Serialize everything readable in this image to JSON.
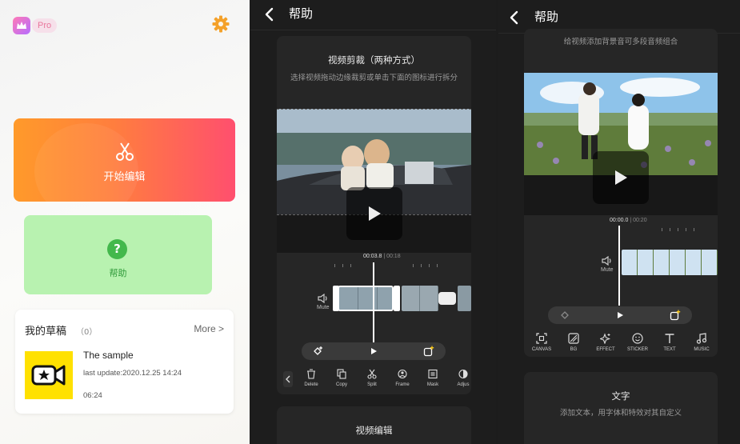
{
  "home": {
    "pro_badge": "Pro",
    "start_edit_label": "开始编辑",
    "help_label": "帮助",
    "drafts_title": "我的草稿",
    "drafts_count": "（0）",
    "more_label": "More >",
    "draft": {
      "name": "The sample",
      "last_update": "last update:2020.12.25 14:24",
      "duration": "06:24"
    }
  },
  "help_trim": {
    "header_title": "帮助",
    "card_title": "视频剪裁（两种方式）",
    "card_desc": "选择视频拖动边缘裁剪或单击下面的图标进行拆分",
    "current_time": "00:03.8",
    "total_time": "00:18",
    "mute_label": "Mute",
    "tools": [
      "Delete",
      "Copy",
      "Split",
      "Frame",
      "Mask",
      "Adjus"
    ],
    "next_card_title": "视频编辑"
  },
  "help_audio": {
    "header_title": "帮助",
    "card_desc": "给视频添加背景音可多段音频组合",
    "current_time": "00:00.0",
    "total_time": "00:20",
    "mute_label": "Mute",
    "tools": [
      "CANVAS",
      "BG",
      "EFFECT",
      "STICKER",
      "TEXT",
      "MUSIC"
    ],
    "text_card_title": "文字",
    "text_card_desc": "添加文本，用字体和特效对其自定义"
  },
  "colors": {
    "start_gradient_left": "#ff9a2a",
    "start_gradient_right": "#ff4f6e",
    "help_card_bg": "#b8f2b0",
    "help_icon": "#43b84c",
    "gear": "#f4a12a",
    "dark_bg": "#1d1d1d"
  }
}
